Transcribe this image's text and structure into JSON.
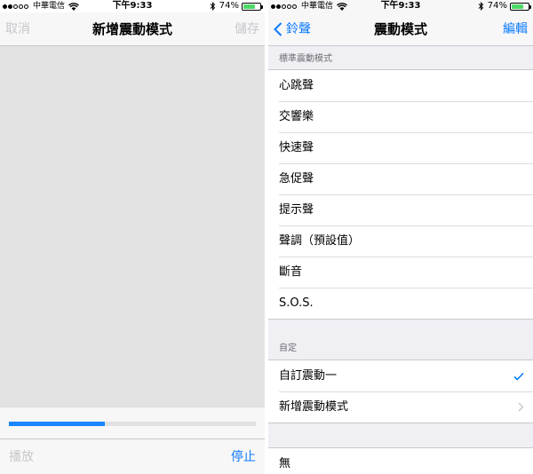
{
  "status_bar": {
    "carrier": "中華電信",
    "time": "下午9:33",
    "battery_percent": "74%",
    "battery_level": 0.74
  },
  "left_screen": {
    "nav": {
      "cancel_label": "取消",
      "title": "新增震動模式",
      "save_label": "儲存"
    },
    "timeline_progress": 0.39,
    "toolbar": {
      "play_label": "播放",
      "stop_label": "停止"
    }
  },
  "right_screen": {
    "nav": {
      "back_label": "鈴聲",
      "title": "震動模式",
      "edit_label": "編輯"
    },
    "standard_section": {
      "header": "標準震動模式",
      "items": [
        "心跳聲",
        "交響樂",
        "快速聲",
        "急促聲",
        "提示聲",
        "聲調（預設值）",
        "斷音",
        "S.O.S."
      ]
    },
    "custom_section": {
      "header": "自定",
      "items": [
        {
          "label": "自訂震動一",
          "accessory": "checkmark"
        },
        {
          "label": "新增震動模式",
          "accessory": "chevron-right"
        }
      ]
    },
    "none_item": "無"
  },
  "colors": {
    "accent": "#0a7aff",
    "disabled": "#c7c7cc",
    "battery": "#4cd964",
    "canvas": "#e3e3e3"
  }
}
